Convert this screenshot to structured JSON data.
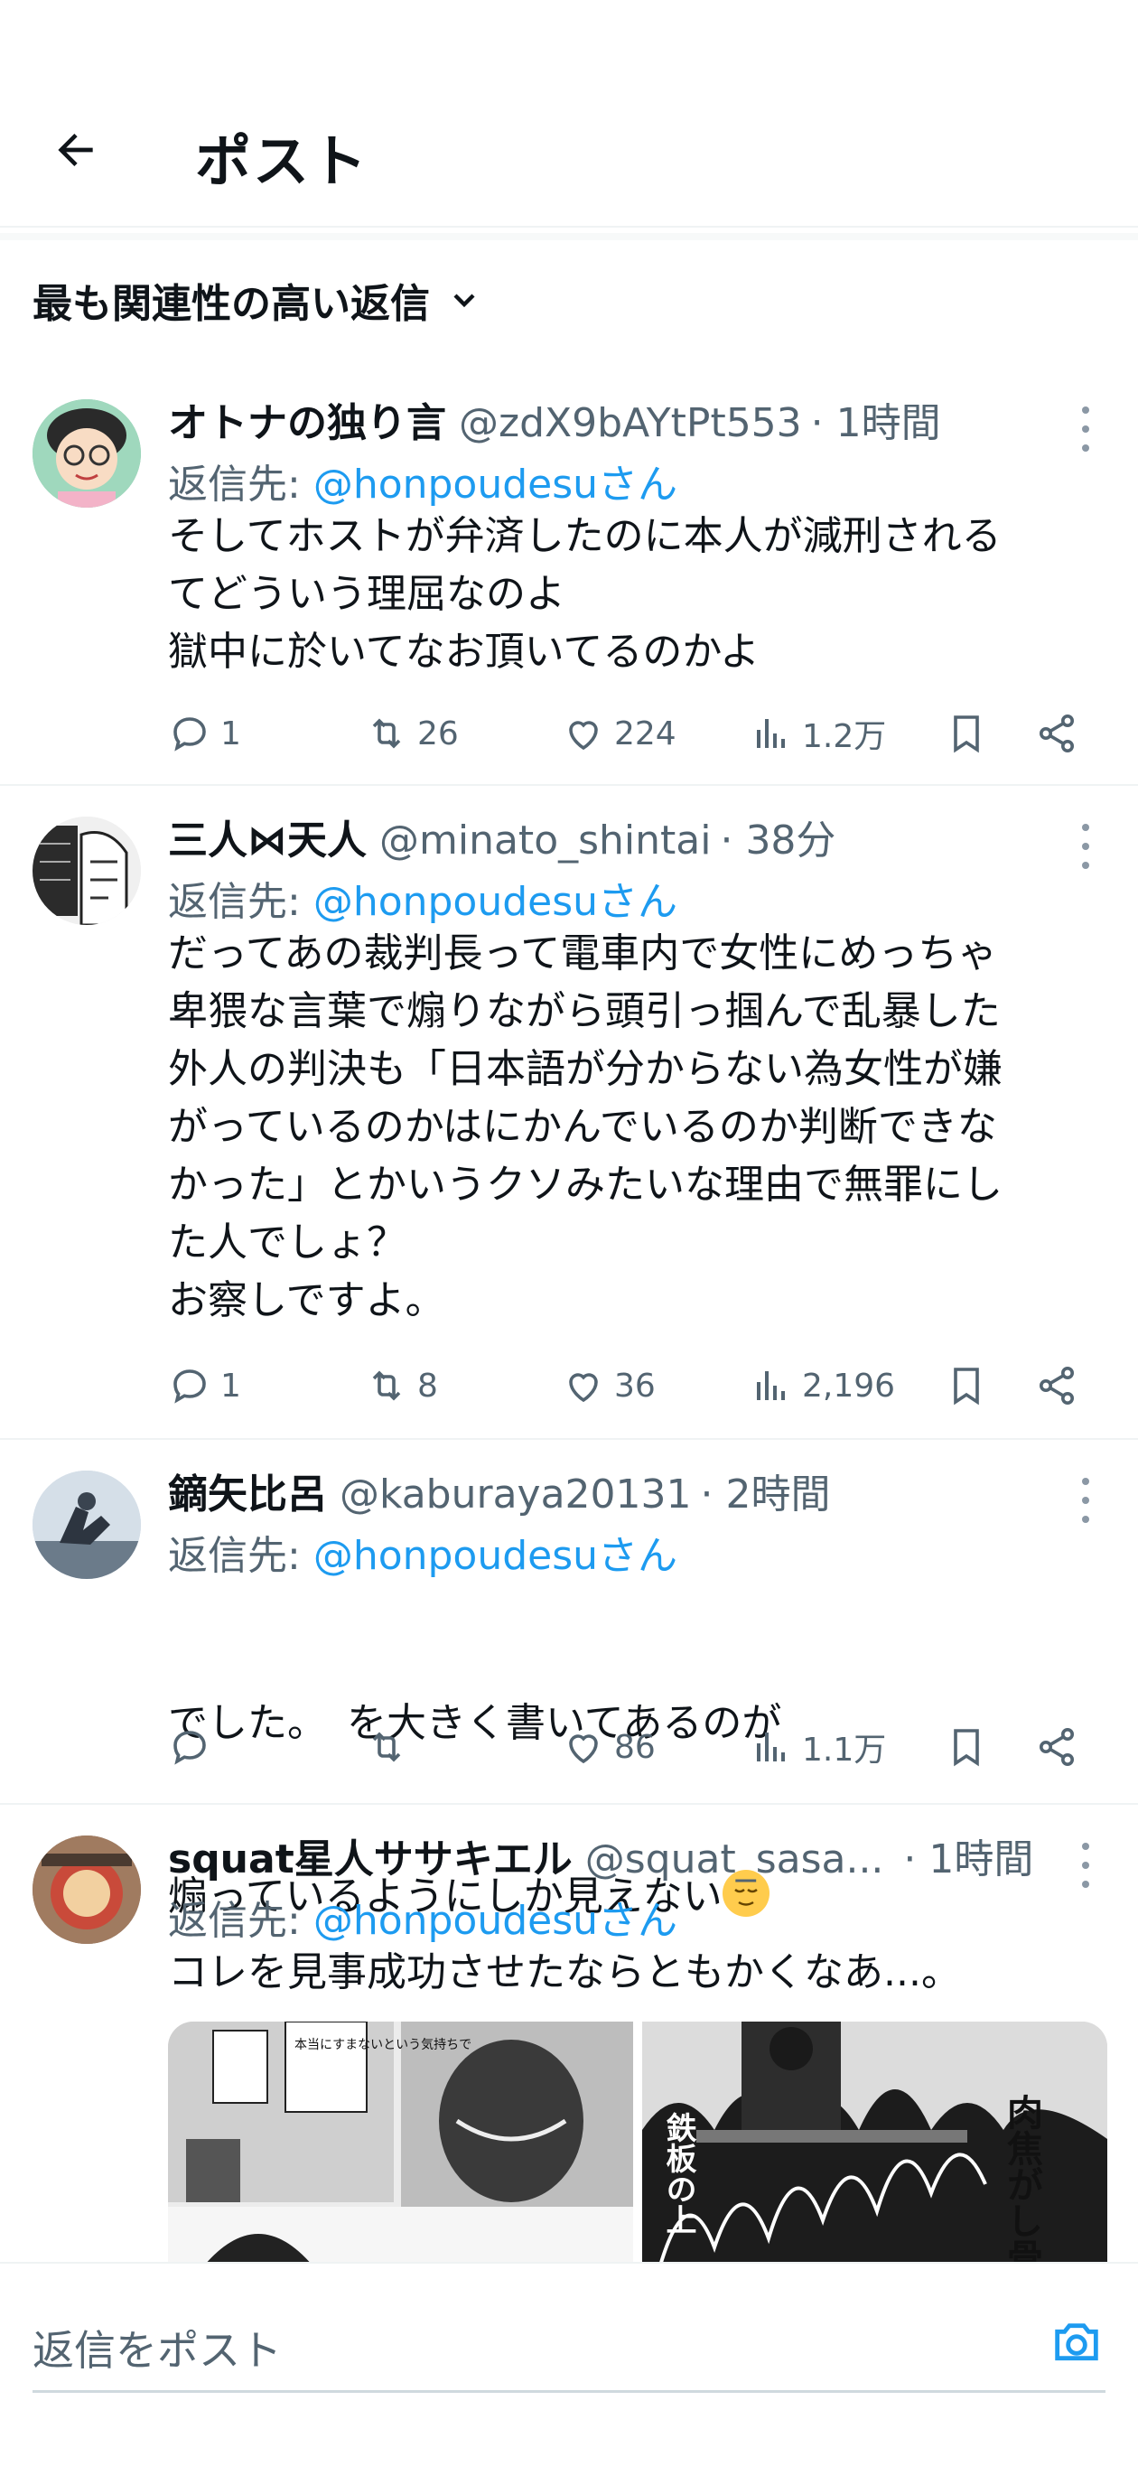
{
  "header": {
    "title": "ポスト"
  },
  "sort": {
    "label": "最も関連性の高い返信"
  },
  "tweets": [
    {
      "name": "オトナの独り言",
      "handle": "@zdX9bAYtPt553",
      "time": "· 1時間",
      "reply_prefix": "返信先: ",
      "reply_to": "@honpoudesuさん",
      "text": "そしてホストが弁済したのに本人が減刑される\nてどういう理屈なのよ\n獄中に於いてなお頂いてるのかよ",
      "replies": "1",
      "retweets": "26",
      "likes": "224",
      "views": "1.2万"
    },
    {
      "name": "三人⋈天人",
      "handle": "@minato_shintai",
      "time": "· 38分",
      "reply_prefix": "返信先: ",
      "reply_to": "@honpoudesuさん",
      "text": "だってあの裁判長って電車内で女性にめっちゃ\n卑猥な言葉で煽りながら頭引っ掴んで乱暴した\n外人の判決も「日本語が分からない為女性が嫌\nがっているのかはにかんでいるのか判断できな\nかった」とかいうクソみたいな理由で無罪にし\nた人でしょ？\nお察しですよ。",
      "replies": "1",
      "retweets": "8",
      "likes": "36",
      "views": "2,196"
    },
    {
      "name": "鏑矢比呂",
      "handle": "@kaburaya20131",
      "time": "· 2時間",
      "reply_prefix": "返信先: ",
      "reply_to": "@honpoudesuさん",
      "text_line1": "でした。　を大きく書いてあるのが",
      "text_line2": "煽っているようにしか見えない",
      "replies": "",
      "retweets": "",
      "likes": "86",
      "views": "1.1万"
    },
    {
      "name": "squat星人ササキエル",
      "handle": "@squat_sasa...",
      "time": "· 1時間",
      "reply_prefix": "返信先: ",
      "reply_to": "@honpoudesuさん",
      "text": "コレを見事成功させたならともかくなあ...。",
      "media_text_1": "本当にすまないという気持ちで",
      "media_text_2": "肉焦がし骨焼く",
      "media_text_3": "鉄板の上"
    }
  ],
  "compose": {
    "placeholder": "返信をポスト"
  }
}
